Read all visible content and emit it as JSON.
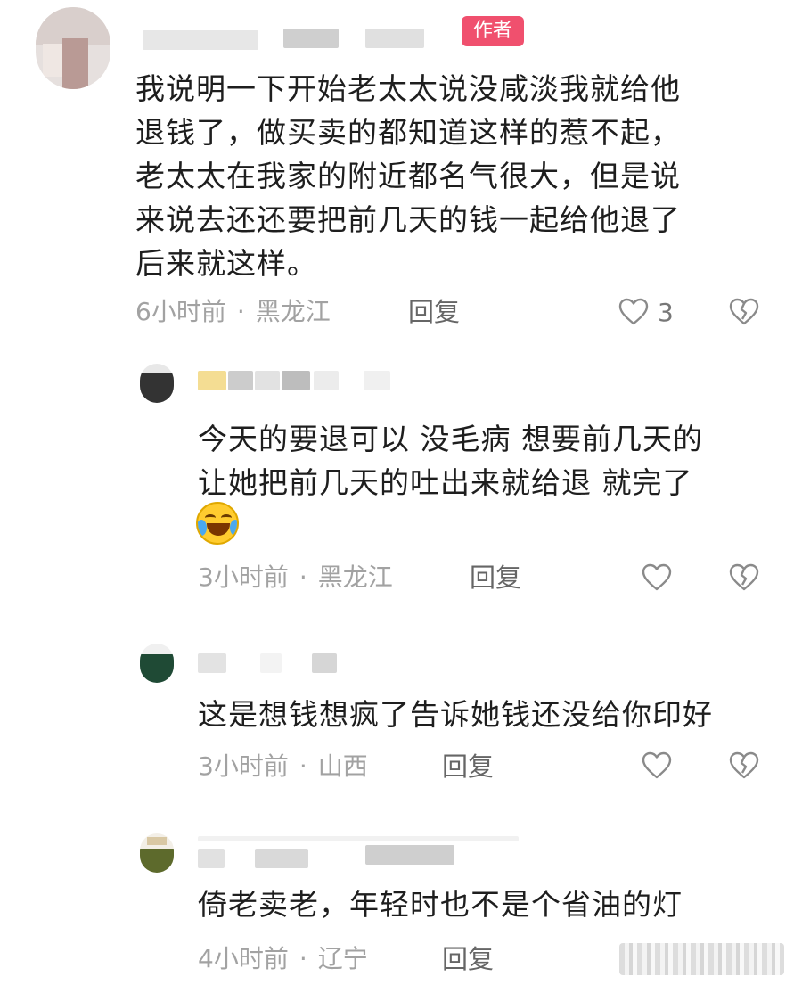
{
  "comments": [
    {
      "badge": "作者",
      "text_lines": [
        "我说明一下开始老太太说没咸淡我就给他",
        "退钱了，做买卖的都知道这样的惹不起，",
        "老太太在我家的附近都名气很大，但是说",
        "来说去还还要把前几天的钱一起给他退了",
        "后来就这样。"
      ],
      "time": "6小时前",
      "location": "黑龙江",
      "reply_label": "回复",
      "like_count": "3"
    },
    {
      "text_lines": [
        "今天的要退可以 没毛病 想要前几天的",
        "让她把前几天的吐出来就给退 就完了"
      ],
      "emoji": "laughing-crying-emoji",
      "time": "3小时前",
      "location": "黑龙江",
      "reply_label": "回复"
    },
    {
      "text_lines": [
        "这是想钱想疯了告诉她钱还没给你印好"
      ],
      "time": "3小时前",
      "location": "山西",
      "reply_label": "回复"
    },
    {
      "text_lines": [
        "倚老卖老，年轻时也不是个省油的灯"
      ],
      "time": "4小时前",
      "location": "辽宁",
      "reply_label": "回复"
    }
  ],
  "meta_separator": "·",
  "colors": {
    "badge": "#f0506e",
    "meta": "#a2a2a2",
    "text": "#1e1e1e"
  },
  "icons": [
    "heart-outline-icon",
    "broken-heart-icon"
  ]
}
